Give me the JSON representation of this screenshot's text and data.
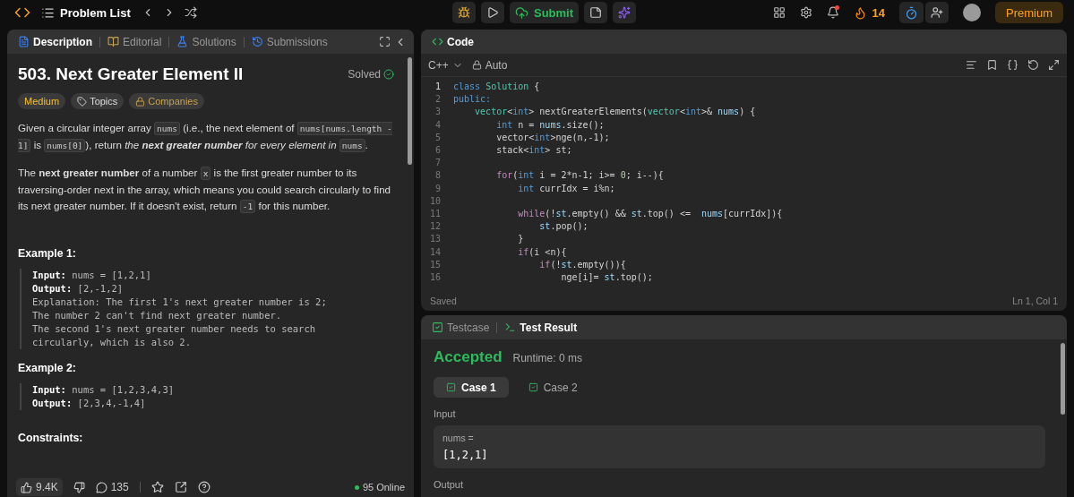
{
  "topbar": {
    "problem_list": "Problem List",
    "submit": "Submit",
    "streak": "14",
    "premium": "Premium",
    "notification_dot": true
  },
  "description": {
    "tabs": [
      {
        "label": "Description",
        "selected": true
      },
      {
        "label": "Editorial",
        "selected": false
      },
      {
        "label": "Solutions",
        "selected": false
      },
      {
        "label": "Submissions",
        "selected": false
      }
    ],
    "title": "503. Next Greater Element II",
    "status": "Solved",
    "tags": [
      {
        "kind": "difficulty",
        "label": "Medium"
      },
      {
        "kind": "topics",
        "label": "Topics"
      },
      {
        "kind": "companies",
        "label": "Companies"
      }
    ],
    "paragraphs": [
      [
        {
          "kind": "text",
          "t": "Given a circular integer array "
        },
        {
          "kind": "code",
          "t": "nums"
        },
        {
          "kind": "text",
          "t": " (i.e., the next element of "
        },
        {
          "kind": "code",
          "t": "nums[nums.length - 1]"
        },
        {
          "kind": "text",
          "t": " is "
        },
        {
          "kind": "code",
          "t": "nums[0]"
        },
        {
          "kind": "text",
          "t": "), return "
        },
        {
          "kind": "em",
          "t": "the "
        },
        {
          "kind": "strongem",
          "t": "next greater number"
        },
        {
          "kind": "em",
          "t": " for every element in "
        },
        {
          "kind": "code",
          "t": "nums"
        },
        {
          "kind": "text",
          "t": "."
        }
      ],
      [
        {
          "kind": "text",
          "t": "The **next greater number** of a number "
        },
        {
          "kind": "code",
          "t": "x"
        },
        {
          "kind": "text",
          "t": " is the first greater number to its traversing-order next in the array, which means you could search circularly to find its next greater number. If it doesn't exist, return "
        },
        {
          "kind": "code",
          "t": "-1"
        },
        {
          "kind": "text",
          "t": " for this number."
        }
      ]
    ],
    "examples": [
      {
        "title": "Example 1:",
        "lines": [
          "**Input:** nums = [1,2,1]",
          "**Output:** [2,-1,2]",
          "Explanation: The first 1's next greater number is 2;",
          "The number 2 can't find next greater number.",
          "The second 1's next greater number needs to search",
          "circularly, which is also 2."
        ]
      },
      {
        "title": "Example 2:",
        "lines": [
          "**Input:** nums = [1,2,3,4,3]",
          "**Output:** [2,3,4,-1,4]"
        ]
      }
    ],
    "constraints_title": "Constraints:",
    "footer": {
      "likes": "9.4K",
      "comments": "135",
      "online": "95 Online"
    }
  },
  "code": {
    "title": "Code",
    "language": "C++",
    "mode": "Auto",
    "status": "Saved",
    "cursor": "Ln 1, Col 1",
    "lines": [
      {
        "n": "1",
        "tokens": [
          {
            "kind": "kw",
            "t": "class "
          },
          {
            "kind": "type",
            "t": "Solution"
          },
          {
            "kind": "p",
            "t": " {"
          }
        ]
      },
      {
        "n": "2",
        "tokens": [
          {
            "kind": "kw",
            "t": "public:"
          }
        ]
      },
      {
        "n": "3",
        "tokens": [
          {
            "kind": "type",
            "t": "    vector"
          },
          {
            "kind": "p",
            "t": "<"
          },
          {
            "kind": "kw",
            "t": "int"
          },
          {
            "kind": "p",
            "t": "> nextGreaterElements("
          },
          {
            "kind": "type",
            "t": "vector"
          },
          {
            "kind": "p",
            "t": "<"
          },
          {
            "kind": "kw",
            "t": "int"
          },
          {
            "kind": "p",
            "t": ">& "
          },
          {
            "kind": "var",
            "t": "nums"
          },
          {
            "kind": "p",
            "t": ") {"
          }
        ]
      },
      {
        "n": "4",
        "tokens": [
          {
            "kind": "kw",
            "t": "        int"
          },
          {
            "kind": "p",
            "t": " n = "
          },
          {
            "kind": "var",
            "t": "nums"
          },
          {
            "kind": "p",
            "t": ".size();"
          }
        ]
      },
      {
        "n": "5",
        "tokens": [
          {
            "kind": "p",
            "t": "        vector<"
          },
          {
            "kind": "kw",
            "t": "int"
          },
          {
            "kind": "p",
            "t": ">nge(n,-1);"
          }
        ]
      },
      {
        "n": "6",
        "tokens": [
          {
            "kind": "p",
            "t": "        stack<"
          },
          {
            "kind": "kw",
            "t": "int"
          },
          {
            "kind": "p",
            "t": "> st;"
          }
        ]
      },
      {
        "n": "7"
      },
      {
        "n": "8",
        "tokens": [
          {
            "kind": "ctl",
            "t": "        for"
          },
          {
            "kind": "p",
            "t": "("
          },
          {
            "kind": "kw",
            "t": "int"
          },
          {
            "kind": "p",
            "t": " i = 2*n-1; i>= "
          },
          {
            "kind": "num",
            "t": "0"
          },
          {
            "kind": "p",
            "t": "; i--){"
          }
        ]
      },
      {
        "n": "9",
        "tokens": [
          {
            "kind": "kw",
            "t": "            int"
          },
          {
            "kind": "p",
            "t": " currIdx = i%n;"
          }
        ]
      },
      {
        "n": "10"
      },
      {
        "n": "11",
        "tokens": [
          {
            "kind": "ctl",
            "t": "            while"
          },
          {
            "kind": "p",
            "t": "(!"
          },
          {
            "kind": "var",
            "t": "st"
          },
          {
            "kind": "p",
            "t": ".empty() && "
          },
          {
            "kind": "var",
            "t": "st"
          },
          {
            "kind": "p",
            "t": ".top() <=  "
          },
          {
            "kind": "var",
            "t": "nums"
          },
          {
            "kind": "p",
            "t": "[currIdx]){"
          }
        ]
      },
      {
        "n": "12",
        "tokens": [
          {
            "kind": "var",
            "t": "                st"
          },
          {
            "kind": "p",
            "t": ".pop();"
          }
        ]
      },
      {
        "n": "13",
        "tokens": [
          {
            "kind": "p",
            "t": "            }"
          }
        ]
      },
      {
        "n": "14",
        "tokens": [
          {
            "kind": "ctl",
            "t": "            if"
          },
          {
            "kind": "p",
            "t": "(i <n){"
          }
        ]
      },
      {
        "n": "15",
        "tokens": [
          {
            "kind": "ctl",
            "t": "                if"
          },
          {
            "kind": "p",
            "t": "(!"
          },
          {
            "kind": "var",
            "t": "st"
          },
          {
            "kind": "p",
            "t": ".empty()){"
          }
        ]
      },
      {
        "n": "16",
        "tokens": [
          {
            "kind": "p",
            "t": "                    nge[i]= "
          },
          {
            "kind": "var",
            "t": "st"
          },
          {
            "kind": "p",
            "t": ".top();"
          }
        ]
      }
    ]
  },
  "tests": {
    "tabs": [
      {
        "label": "Testcase",
        "selected": false
      },
      {
        "label": "Test Result",
        "selected": true
      }
    ],
    "verdict": "Accepted",
    "runtime": "Runtime: 0 ms",
    "cases": [
      {
        "label": "Case 1",
        "selected": true,
        "passed": true
      },
      {
        "label": "Case 2",
        "selected": false,
        "passed": true
      }
    ],
    "input_label": "Input",
    "input_name": "nums =",
    "input_value": "[1,2,1]",
    "output_label": "Output"
  }
}
